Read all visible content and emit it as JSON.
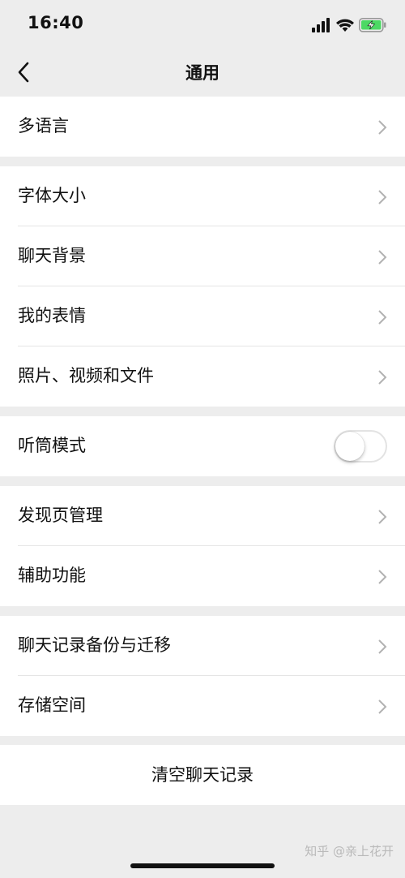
{
  "status": {
    "time": "16:40",
    "signal_icon": "cellular-signal-icon",
    "wifi_icon": "wifi-icon",
    "battery_icon": "battery-charging-icon"
  },
  "nav": {
    "title": "通用",
    "back_icon": "chevron-left-icon"
  },
  "groups": [
    {
      "items": [
        {
          "label": "多语言"
        }
      ]
    },
    {
      "items": [
        {
          "label": "字体大小"
        },
        {
          "label": "聊天背景"
        },
        {
          "label": "我的表情"
        },
        {
          "label": "照片、视频和文件"
        }
      ]
    },
    {
      "items": [
        {
          "label": "听筒模式",
          "toggle": false
        }
      ]
    },
    {
      "items": [
        {
          "label": "发现页管理"
        },
        {
          "label": "辅助功能"
        }
      ]
    },
    {
      "items": [
        {
          "label": "聊天记录备份与迁移"
        },
        {
          "label": "存储空间"
        }
      ]
    }
  ],
  "clear_button": {
    "label": "清空聊天记录"
  },
  "watermark": {
    "text": "知乎 @亲上花开"
  },
  "colors": {
    "background": "#ededed",
    "battery_fill": "#4cd964",
    "chevron": "#b2b2b2"
  }
}
